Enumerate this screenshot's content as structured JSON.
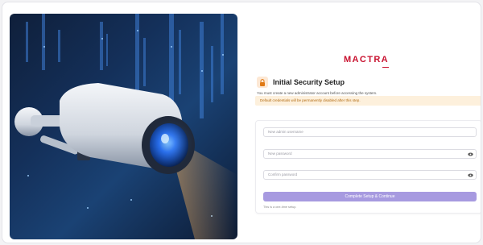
{
  "brand": {
    "name": "MACTRA",
    "color": "#c8102e"
  },
  "setup": {
    "icon": "lock-icon",
    "title": "Initial Security Setup",
    "subtitle": "You must create a new administrator account before accessing the system.",
    "warning": "Default credentials will be permanently disabled after this step.",
    "warning_color": "#b26b12",
    "warning_bg": "#fdf0dc"
  },
  "form": {
    "username_placeholder": "New admin username",
    "password_placeholder": "New password",
    "confirm_placeholder": "Confirm password",
    "password_toggle_icon": "eye-icon",
    "confirm_toggle_icon": "eye-icon",
    "submit_label": "Complete Setup & Continue",
    "submit_color": "#a79ae0",
    "note": "This is a one-time setup."
  },
  "hero": {
    "description_icon": "security-camera-image"
  }
}
